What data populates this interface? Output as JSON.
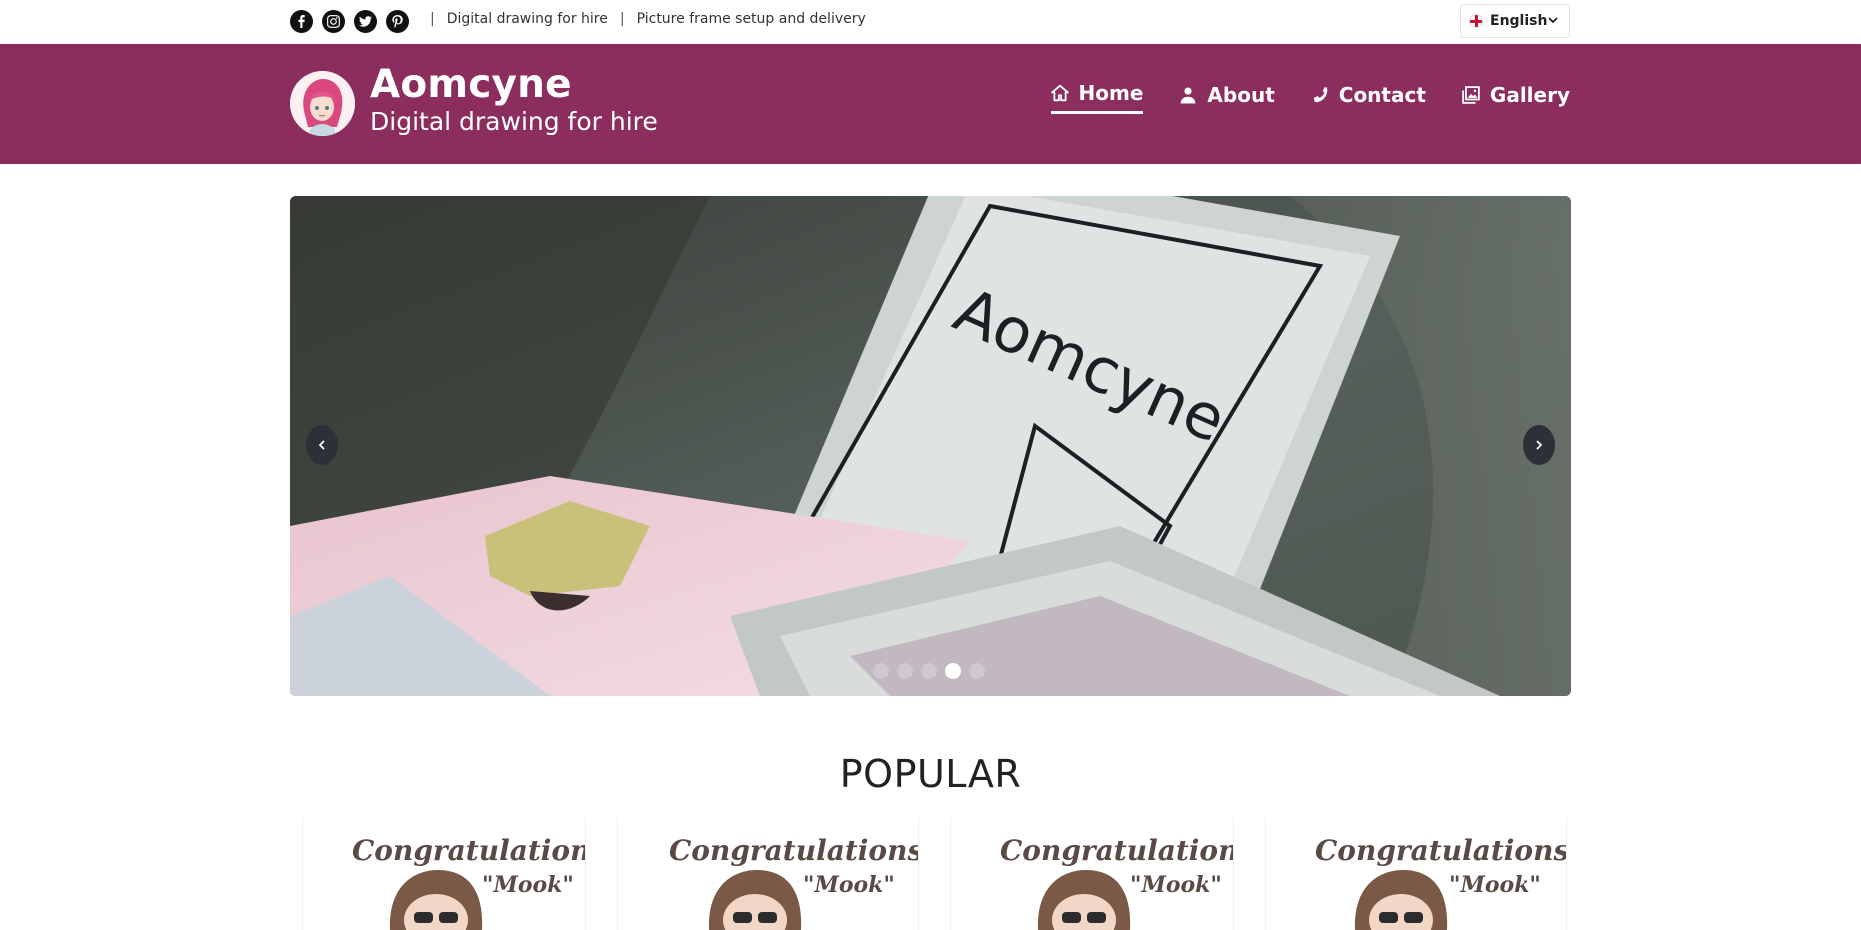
{
  "topbar": {
    "social": [
      {
        "name": "facebook-icon"
      },
      {
        "name": "instagram-icon"
      },
      {
        "name": "twitter-icon"
      },
      {
        "name": "pinterest-icon"
      }
    ],
    "link_1": "Digital drawing for hire",
    "link_2": "Picture frame setup and delivery",
    "separator": "|",
    "language": "English"
  },
  "header": {
    "title": "Aomcyne",
    "subtitle": "Digital drawing for hire",
    "background": "#8b2e5e",
    "nav": {
      "home": "Home",
      "about": "About",
      "contact": "Contact",
      "gallery": "Gallery"
    },
    "active_nav": "home"
  },
  "carousel": {
    "frame_text": "Aomcyne",
    "slide_count": 5,
    "active_slide": 4
  },
  "popular": {
    "title": "POPULAR",
    "cards": [
      {
        "text": "Congratulations",
        "name": "\"Mook\""
      },
      {
        "text": "Congratulations",
        "name": "\"Mook\""
      },
      {
        "text": "Congratulations",
        "name": "\"Mook\""
      },
      {
        "text": "Congratulations",
        "name": "\"Mook\""
      }
    ]
  }
}
